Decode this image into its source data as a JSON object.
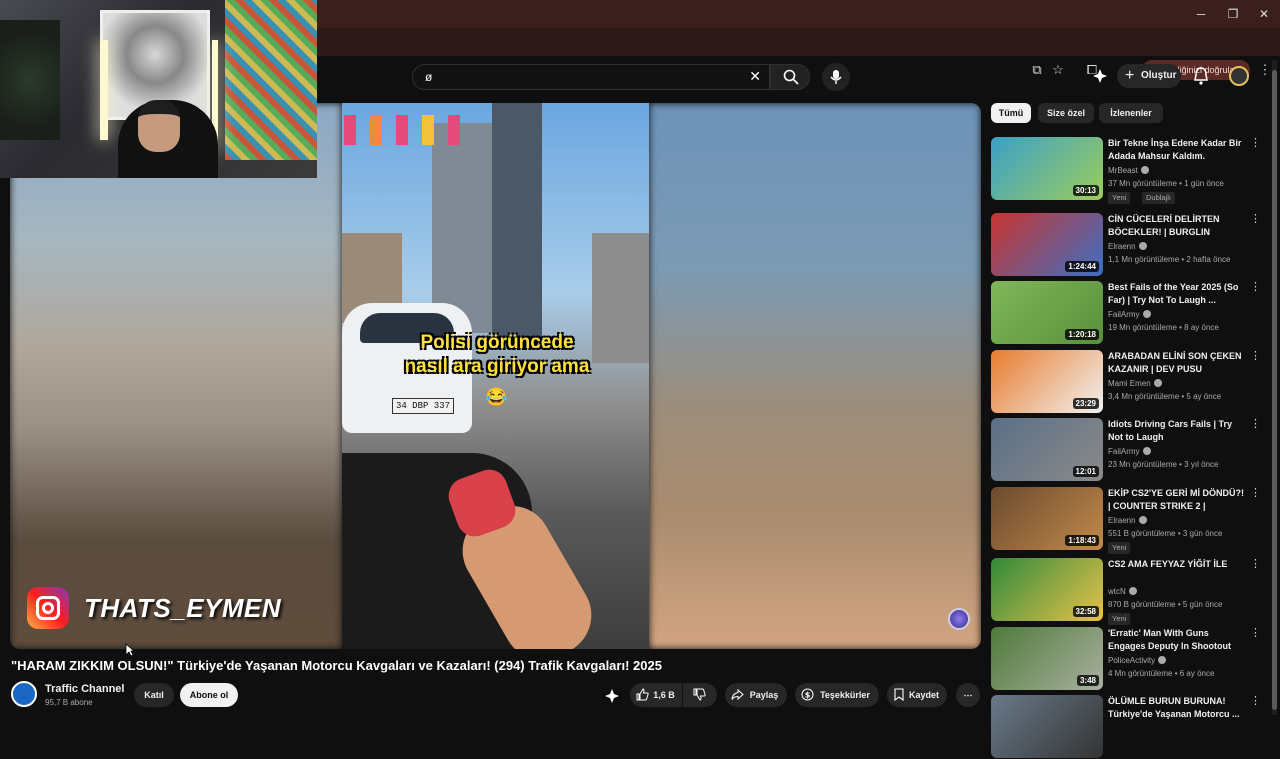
{
  "browser": {
    "identity_label": "Kimliğinizi doğrulayın",
    "window_controls": [
      "minimize-icon",
      "restore-icon",
      "close-icon"
    ]
  },
  "header": {
    "search_value": "ø",
    "create_label": "Oluştur"
  },
  "video": {
    "caption_line1": "Polisi görüncede",
    "caption_line2": "nasıl ara giriyor ama",
    "plate": "34 DBP 337",
    "emoji": "😂",
    "ig_handle": "THATS_EYMEN",
    "title": "\"HARAM ZIKKIM OLSUN!\" Türkiye'de Yaşanan Motorcu Kavgaları ve Kazaları! (294) Trafik Kavgaları! 2025"
  },
  "channel": {
    "name": "Traffic Channel",
    "subscribers": "95,7 B abone",
    "join_label": "Katıl",
    "subscribe_label": "Abone ol"
  },
  "actions": {
    "likes": "1,6 B",
    "share": "Paylaş",
    "thanks": "Teşekkürler",
    "save": "Kaydet"
  },
  "sidebar": {
    "chips": [
      "Tümü",
      "Size özel",
      "İzlenenler"
    ],
    "items": [
      {
        "title": "Bir Tekne İnşa Edene Kadar Bir Adada Mahsur Kaldım.",
        "channel": "MrBeast",
        "meta": "37 Mn görüntüleme • 1 gün önce",
        "duration": "30:13",
        "badges": [
          "Yeni",
          "Dublajlı"
        ],
        "colors": [
          "#3aa0c7",
          "#9ccd5a"
        ]
      },
      {
        "title": "CİN CÜCELERİ DELİRTEN BÖCEKLER! | BURGLIN GNOM...",
        "channel": "Elraenn",
        "meta": "1,1 Mn görüntüleme • 2 hafta önce",
        "duration": "1:24:44",
        "badges": [],
        "colors": [
          "#c9352f",
          "#3b6fc4"
        ]
      },
      {
        "title": "Best Fails of the Year 2025 (So Far) | Try Not To Laugh ...",
        "channel": "FailArmy",
        "meta": "19 Mn görüntüleme • 8 ay önce",
        "duration": "1:20:18",
        "badges": [],
        "colors": [
          "#7fb85a",
          "#5a8f3a"
        ]
      },
      {
        "title": "ARABADAN ELİNİ SON ÇEKEN KAZANIR | DEV PUSU",
        "channel": "Mami Emen",
        "meta": "3,4 Mn görüntüleme • 5 ay önce",
        "duration": "23:29",
        "badges": [],
        "colors": [
          "#e87b2c",
          "#f2f2f2"
        ]
      },
      {
        "title": "Idiots Driving Cars Fails | Try Not to Laugh",
        "channel": "FailArmy",
        "meta": "23 Mn görüntüleme • 3 yıl önce",
        "duration": "12:01",
        "badges": [],
        "colors": [
          "#5b6f86",
          "#8a8a8a"
        ]
      },
      {
        "title": "EKİP CS2'YE GERİ Mİ DÖNDÜ?! | COUNTER STRIKE 2 |",
        "channel": "Elraenn",
        "meta": "551 B görüntüleme • 3 gün önce",
        "duration": "1:18:43",
        "badges": [
          "Yeni"
        ],
        "colors": [
          "#6b4a2f",
          "#c28a4a"
        ]
      },
      {
        "title": "CS2 AMA FEYYAZ YİĞİT İLE",
        "channel": "wtcN",
        "meta": "870 B görüntüleme • 5 gün önce",
        "duration": "32:58",
        "badges": [
          "Yeni"
        ],
        "colors": [
          "#2f8a3a",
          "#e8c24a"
        ]
      },
      {
        "title": "'Erratic' Man With Guns Engages Deputy In Shootout",
        "channel": "PoliceActivity",
        "meta": "4 Mn görüntüleme • 6 ay önce",
        "duration": "3:48",
        "badges": [],
        "colors": [
          "#4f7a3a",
          "#a9b0a0"
        ]
      },
      {
        "title": "ÖLÜMLE BURUN BURUNA! Türkiye'de Yaşanan Motorcu ...",
        "channel": "",
        "meta": "",
        "duration": "",
        "badges": [],
        "colors": [
          "#6a7a8a",
          "#333"
        ]
      }
    ]
  }
}
